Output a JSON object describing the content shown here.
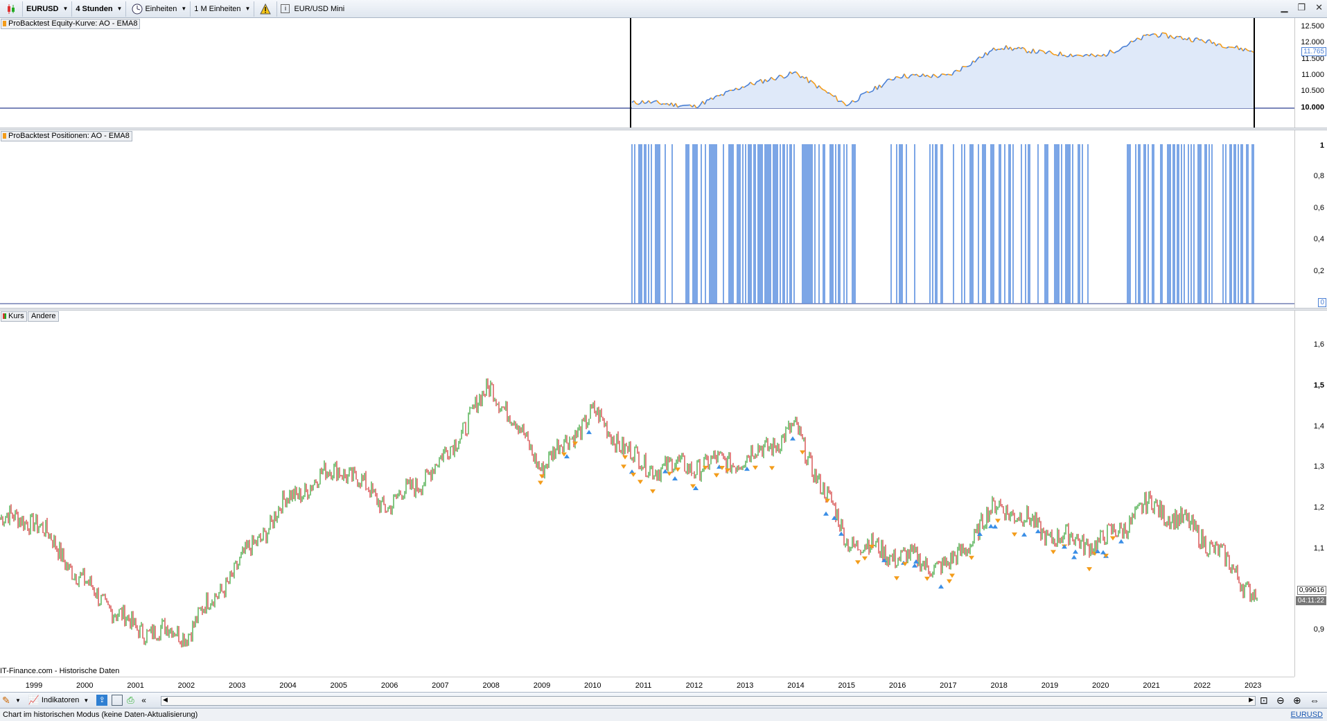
{
  "toolbar": {
    "symbol": "EURUSD",
    "timeframe": "4 Stunden",
    "units_label": "Einheiten",
    "units_count": "1 M Einheiten",
    "instrument_name": "EUR/USD Mini"
  },
  "panels": {
    "equity": {
      "label": "ProBacktest Equity-Kurve: AO - EMA8"
    },
    "positions": {
      "label": "ProBacktest Positionen: AO - EMA8"
    },
    "price": {
      "label": "Kurs",
      "other_tab": "Andere"
    }
  },
  "colors": {
    "equity_up": "#4a7fd4",
    "equity_down": "#f39c1a",
    "candle_up": "#2ea02e",
    "candle_down": "#d03030",
    "position": "#5b8fe0",
    "baseline": "#2b3f8f"
  },
  "equity_axis": {
    "ticks": [
      "12.500",
      "12.000",
      "11.500",
      "11.000",
      "10.500",
      "10.000"
    ],
    "current": "11.765"
  },
  "positions_axis": {
    "ticks": [
      "1",
      "0,8",
      "0,6",
      "0,4",
      "0,2"
    ],
    "current": "0"
  },
  "price_axis": {
    "ticks": [
      "1,6",
      "1,5",
      "1,4",
      "1,3",
      "1,2",
      "1,1",
      "0,9"
    ],
    "current_price": "0,99616",
    "current_time": "04:11:22"
  },
  "source_note": "IT-Finance.com - Historische Daten",
  "x_axis": {
    "years": [
      "1999",
      "2000",
      "2001",
      "2002",
      "2003",
      "2004",
      "2005",
      "2006",
      "2007",
      "2008",
      "2009",
      "2010",
      "2011",
      "2012",
      "2013",
      "2014",
      "2015",
      "2016",
      "2017",
      "2018",
      "2019",
      "2020",
      "2021",
      "2022",
      "2023"
    ]
  },
  "chart_data": {
    "type": "line",
    "x": [
      1999,
      2000,
      2001,
      2002,
      2003,
      2004,
      2005,
      2006,
      2007,
      2008,
      2009,
      2010,
      2011,
      2012,
      2013,
      2014,
      2015,
      2016,
      2017,
      2018,
      2019,
      2020,
      2021,
      2022,
      2023
    ],
    "series": [
      {
        "name": "Kurs",
        "values": [
          1.17,
          1.01,
          0.9,
          0.89,
          1.05,
          1.22,
          1.3,
          1.2,
          1.31,
          1.5,
          1.3,
          1.43,
          1.3,
          1.3,
          1.32,
          1.39,
          1.12,
          1.08,
          1.05,
          1.21,
          1.13,
          1.11,
          1.21,
          1.13,
          0.99
        ]
      },
      {
        "name": "ProBacktest Equity-Kurve: AO - EMA8",
        "values": [
          null,
          null,
          null,
          null,
          null,
          null,
          null,
          null,
          null,
          null,
          null,
          10000,
          10200,
          10050,
          10700,
          11100,
          10100,
          11000,
          11000,
          11900,
          11700,
          11600,
          12300,
          12100,
          11765
        ]
      }
    ],
    "ylim": [
      0.85,
      1.65
    ]
  },
  "bottombar": {
    "indicators": "Indikatoren",
    "symbol_link": "EURUSD"
  },
  "status": {
    "text": "Chart im historischen Modus (keine Daten-Aktualisierung)"
  }
}
